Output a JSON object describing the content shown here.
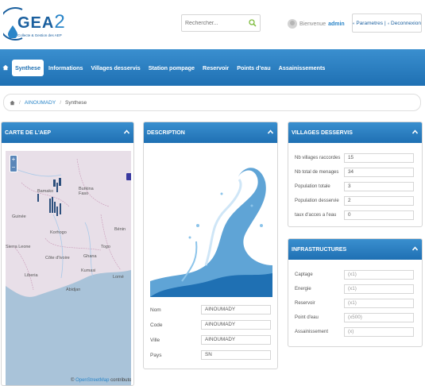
{
  "header": {
    "logo_text": "GEA",
    "logo_num": "2",
    "logo_subtitle": "Collecte & Gestion des AEP",
    "search_placeholder": "Rechercher...",
    "welcome": "Bienvenue",
    "username": "admin",
    "settings_label": "Parametres",
    "logout_label": "Deconnexion"
  },
  "nav": {
    "items": [
      {
        "label": "Synthese",
        "active": true
      },
      {
        "label": "Informations"
      },
      {
        "label": "Villages desservis"
      },
      {
        "label": "Station pompage"
      },
      {
        "label": "Reservoir"
      },
      {
        "label": "Points d'eau"
      },
      {
        "label": "Assainissements"
      }
    ]
  },
  "breadcrumb": {
    "items": [
      "AINOUMADY",
      "Synthese"
    ]
  },
  "map_panel": {
    "title": "CARTE DE L'AEP",
    "attribution_prefix": "©",
    "attribution_link": "OpenStreetMap",
    "attribution_suffix": "contributors",
    "labels": [
      "Bamako",
      "Burkina Faso",
      "Guinée",
      "Korhogo",
      "Côte d'Ivoire",
      "Ghana",
      "Togo",
      "Bénin",
      "Liberia",
      "Kumasi",
      "Abidjan",
      "Lomé",
      "Sierra Leone"
    ],
    "colors": {
      "land": "#e8dfe8",
      "sea": "#a9c3d9"
    }
  },
  "description_panel": {
    "title": "DESCRIPTION",
    "fields": [
      {
        "label": "Nom",
        "value": "AINOUMADY"
      },
      {
        "label": "Code",
        "value": "AINOUMADY"
      },
      {
        "label": "Ville",
        "value": "AINOUMADY"
      },
      {
        "label": "Pays",
        "value": "SN"
      }
    ]
  },
  "villages_panel": {
    "title": "VILLAGES DESSERVIS",
    "fields": [
      {
        "label": "Nb villages raccordes",
        "value": "15"
      },
      {
        "label": "Nb total de menages",
        "value": "34"
      },
      {
        "label": "Population totale",
        "value": "3"
      },
      {
        "label": "Population desservie",
        "value": "2"
      },
      {
        "label": "taux d'acces a l'eau",
        "value": "0"
      }
    ]
  },
  "infra_panel": {
    "title": "INFRASTRUCTURES",
    "fields": [
      {
        "label": "Captage",
        "value": "(x1)"
      },
      {
        "label": "Energie",
        "value": "(x1)"
      },
      {
        "label": "Reservoir",
        "value": "(x1)"
      },
      {
        "label": "Point d'eau",
        "value": "(x500)"
      },
      {
        "label": "Assainissement",
        "value": "(x)"
      }
    ]
  },
  "colors": {
    "primary": "#1f70b3",
    "accent": "#2a85c8"
  }
}
